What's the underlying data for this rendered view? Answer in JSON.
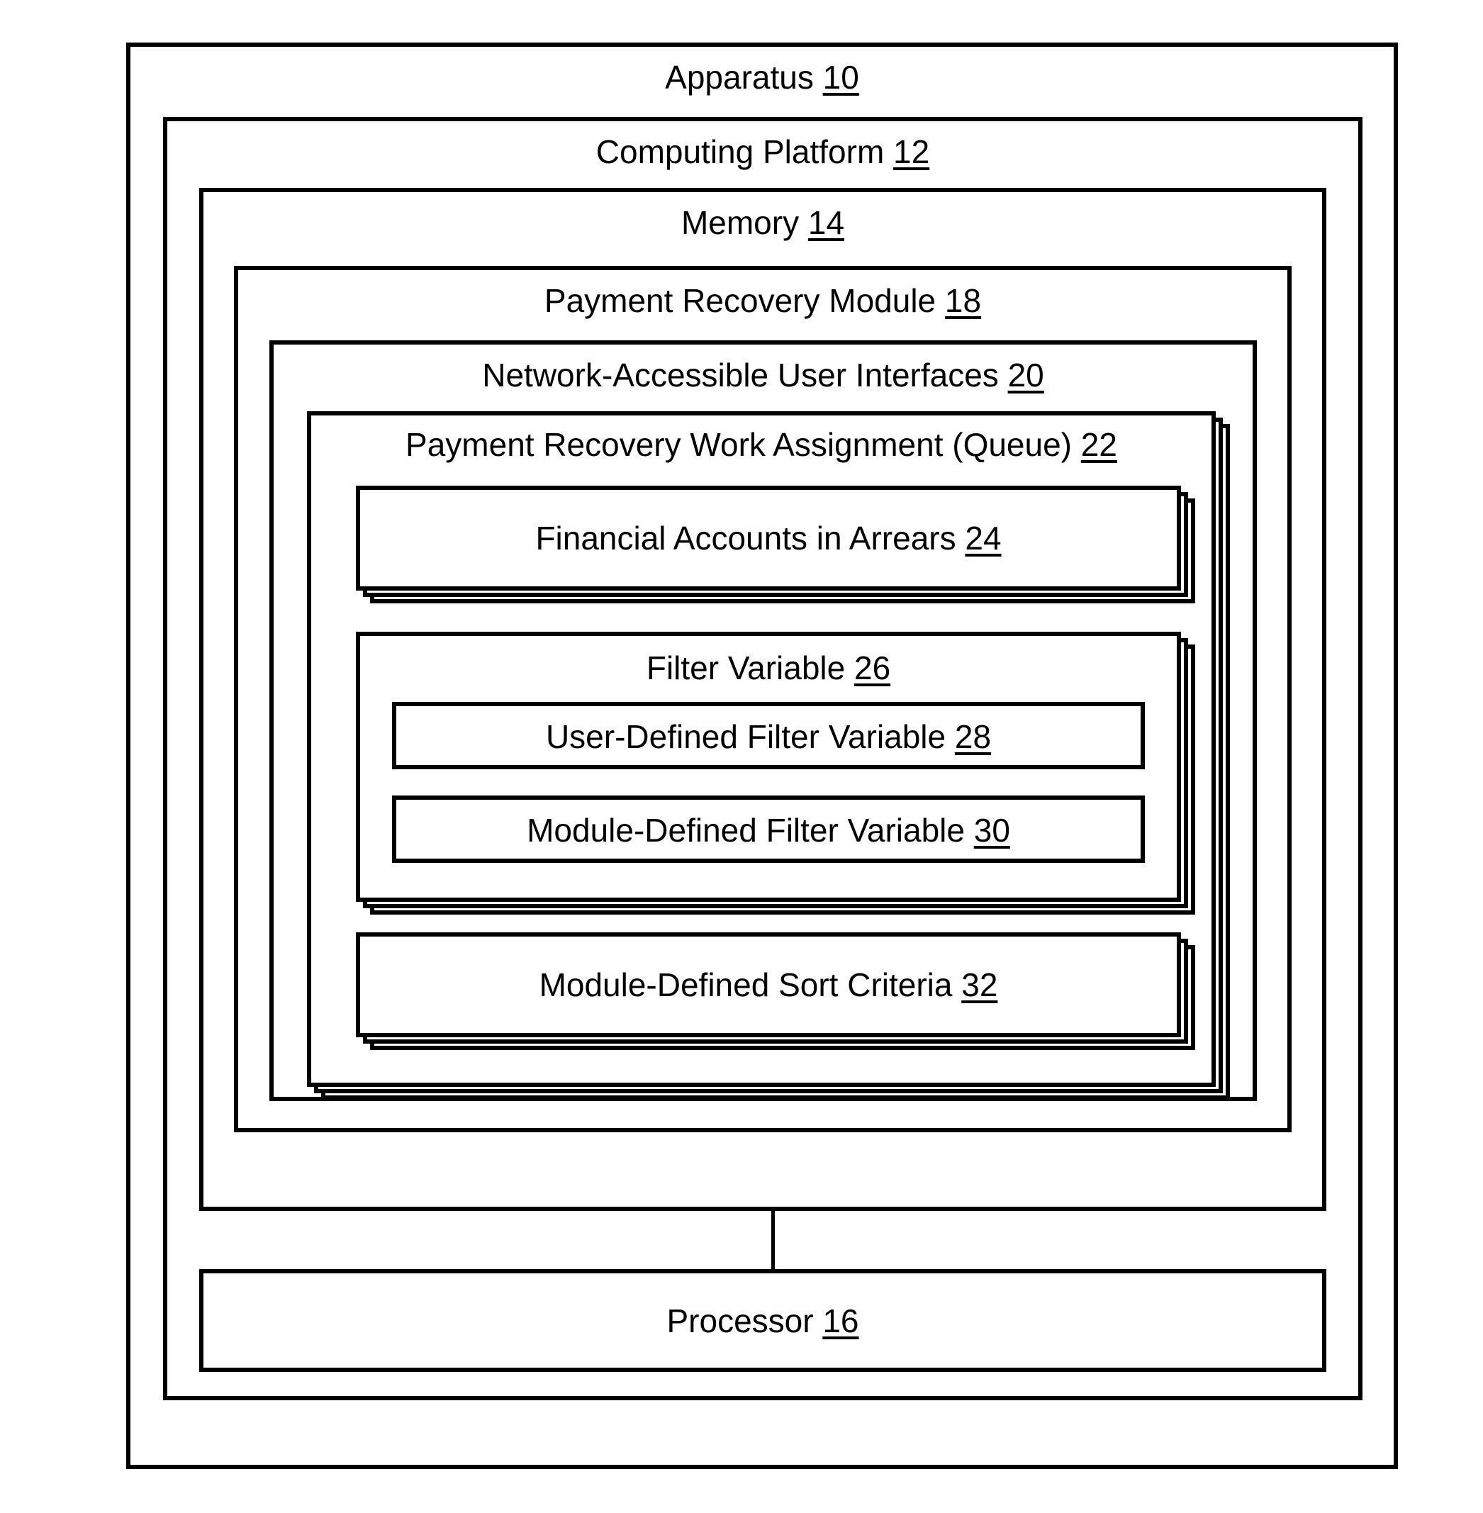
{
  "diagram": {
    "type": "patent-block-diagram",
    "boxes": {
      "apparatus": {
        "label": "Apparatus",
        "ref": "10"
      },
      "computing": {
        "label": "Computing Platform",
        "ref": "12"
      },
      "memory": {
        "label": "Memory",
        "ref": "14"
      },
      "payment_module": {
        "label": "Payment Recovery Module",
        "ref": "18"
      },
      "nai": {
        "label": "Network-Accessible User Interfaces",
        "ref": "20"
      },
      "queue": {
        "label": "Payment Recovery Work Assignment (Queue)",
        "ref": "22"
      },
      "financial_accts": {
        "label": "Financial Accounts in Arrears",
        "ref": "24"
      },
      "filter_var": {
        "label": "Filter Variable",
        "ref": "26"
      },
      "user_filter_var": {
        "label": "User-Defined Filter Variable",
        "ref": "28"
      },
      "module_filter_var": {
        "label": "Module-Defined Filter Variable",
        "ref": "30"
      },
      "sort_criteria": {
        "label": "Module-Defined Sort Criteria",
        "ref": "32"
      },
      "processor": {
        "label": "Processor",
        "ref": "16"
      }
    },
    "colors": {
      "stroke": "#000000",
      "fill": "#ffffff"
    }
  }
}
